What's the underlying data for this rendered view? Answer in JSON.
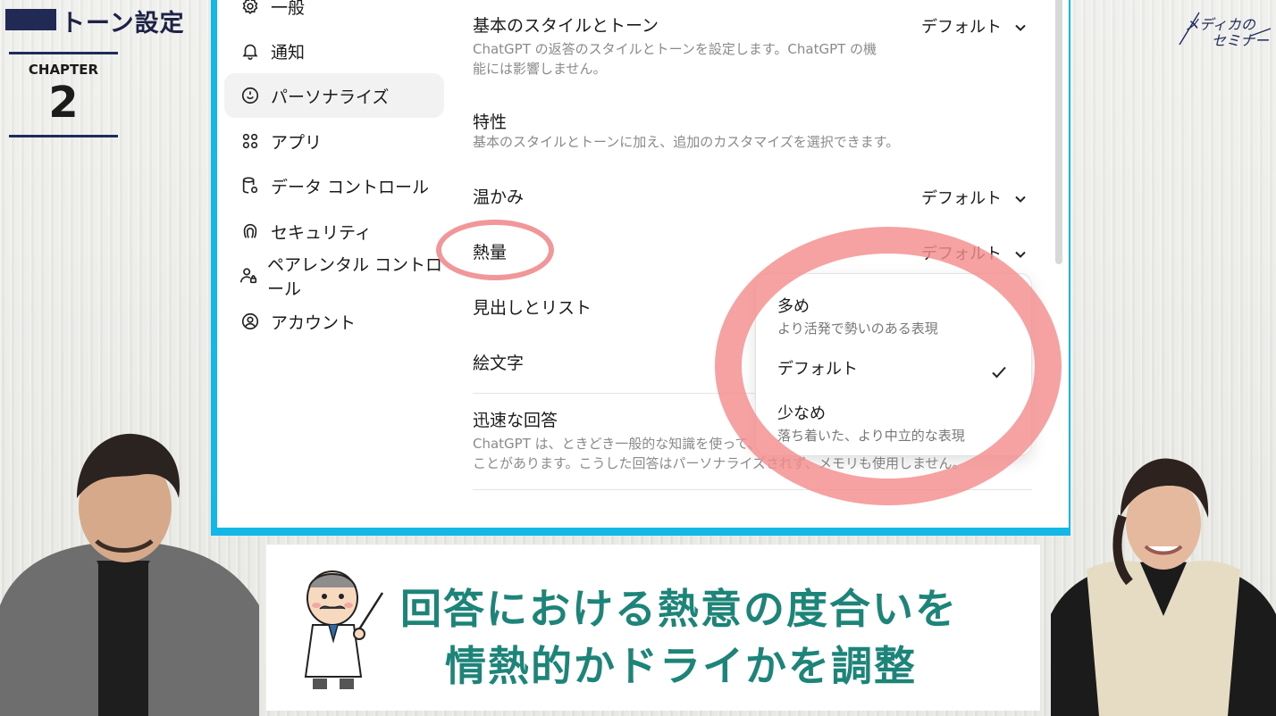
{
  "header": {
    "title": "トーン設定"
  },
  "chapter": {
    "label": "CHAPTER",
    "number": "2"
  },
  "logo": {
    "line1": "メディカの",
    "line2": "セミナー"
  },
  "sidebar": {
    "items": [
      {
        "label": "一般",
        "icon": "gear-icon"
      },
      {
        "label": "通知",
        "icon": "bell-icon"
      },
      {
        "label": "パーソナライズ",
        "icon": "personalize-icon"
      },
      {
        "label": "アプリ",
        "icon": "apps-grid-icon"
      },
      {
        "label": "データ コントロール",
        "icon": "database-icon"
      },
      {
        "label": "セキュリティ",
        "icon": "fingerprint-icon"
      },
      {
        "label": "ペアレンタル コントロール",
        "icon": "parental-user-icon"
      },
      {
        "label": "アカウント",
        "icon": "account-circle-icon"
      }
    ]
  },
  "settings": {
    "base_style": {
      "label": "基本のスタイルとトーン",
      "value": "デフォルト",
      "description_line1": "ChatGPT の返答のスタイルとトーンを設定します。ChatGPT の機",
      "description_line2": "能には影響しません。"
    },
    "traits": {
      "label": "特性",
      "description": "基本のスタイルとトーンに加え、追加のカスタマイズを選択できます。"
    },
    "warmth": {
      "label": "温かみ",
      "value": "デフォルト"
    },
    "enthusiasm": {
      "label": "熱量",
      "value": "デフォルト"
    },
    "headers_lists": {
      "label": "見出しとリスト"
    },
    "emoji": {
      "label": "絵文字"
    },
    "quick_answers": {
      "label": "迅速な回答",
      "description_line1": "ChatGPT は、ときどき一般的な知識を使って、す",
      "description_line2": "ことがあります。こうした回答はパーソナライズされず、メモリも使用しません。"
    }
  },
  "dropdown": {
    "options": [
      {
        "label": "多め",
        "sub": "より活発で勢いのある表現"
      },
      {
        "label": "デフォルト",
        "sub": "",
        "selected": true
      },
      {
        "label": "少なめ",
        "sub": "落ち着いた、より中立的な表現"
      }
    ]
  },
  "caption": {
    "line1": "回答における熱意の度合いを",
    "line2": "情熱的かドライかを調整"
  },
  "colors": {
    "accent_frame": "#13b8e6",
    "caption_text": "#1d8479",
    "highlight_ring": "#f48d8f",
    "chapter_navy": "#1f2b5c"
  }
}
